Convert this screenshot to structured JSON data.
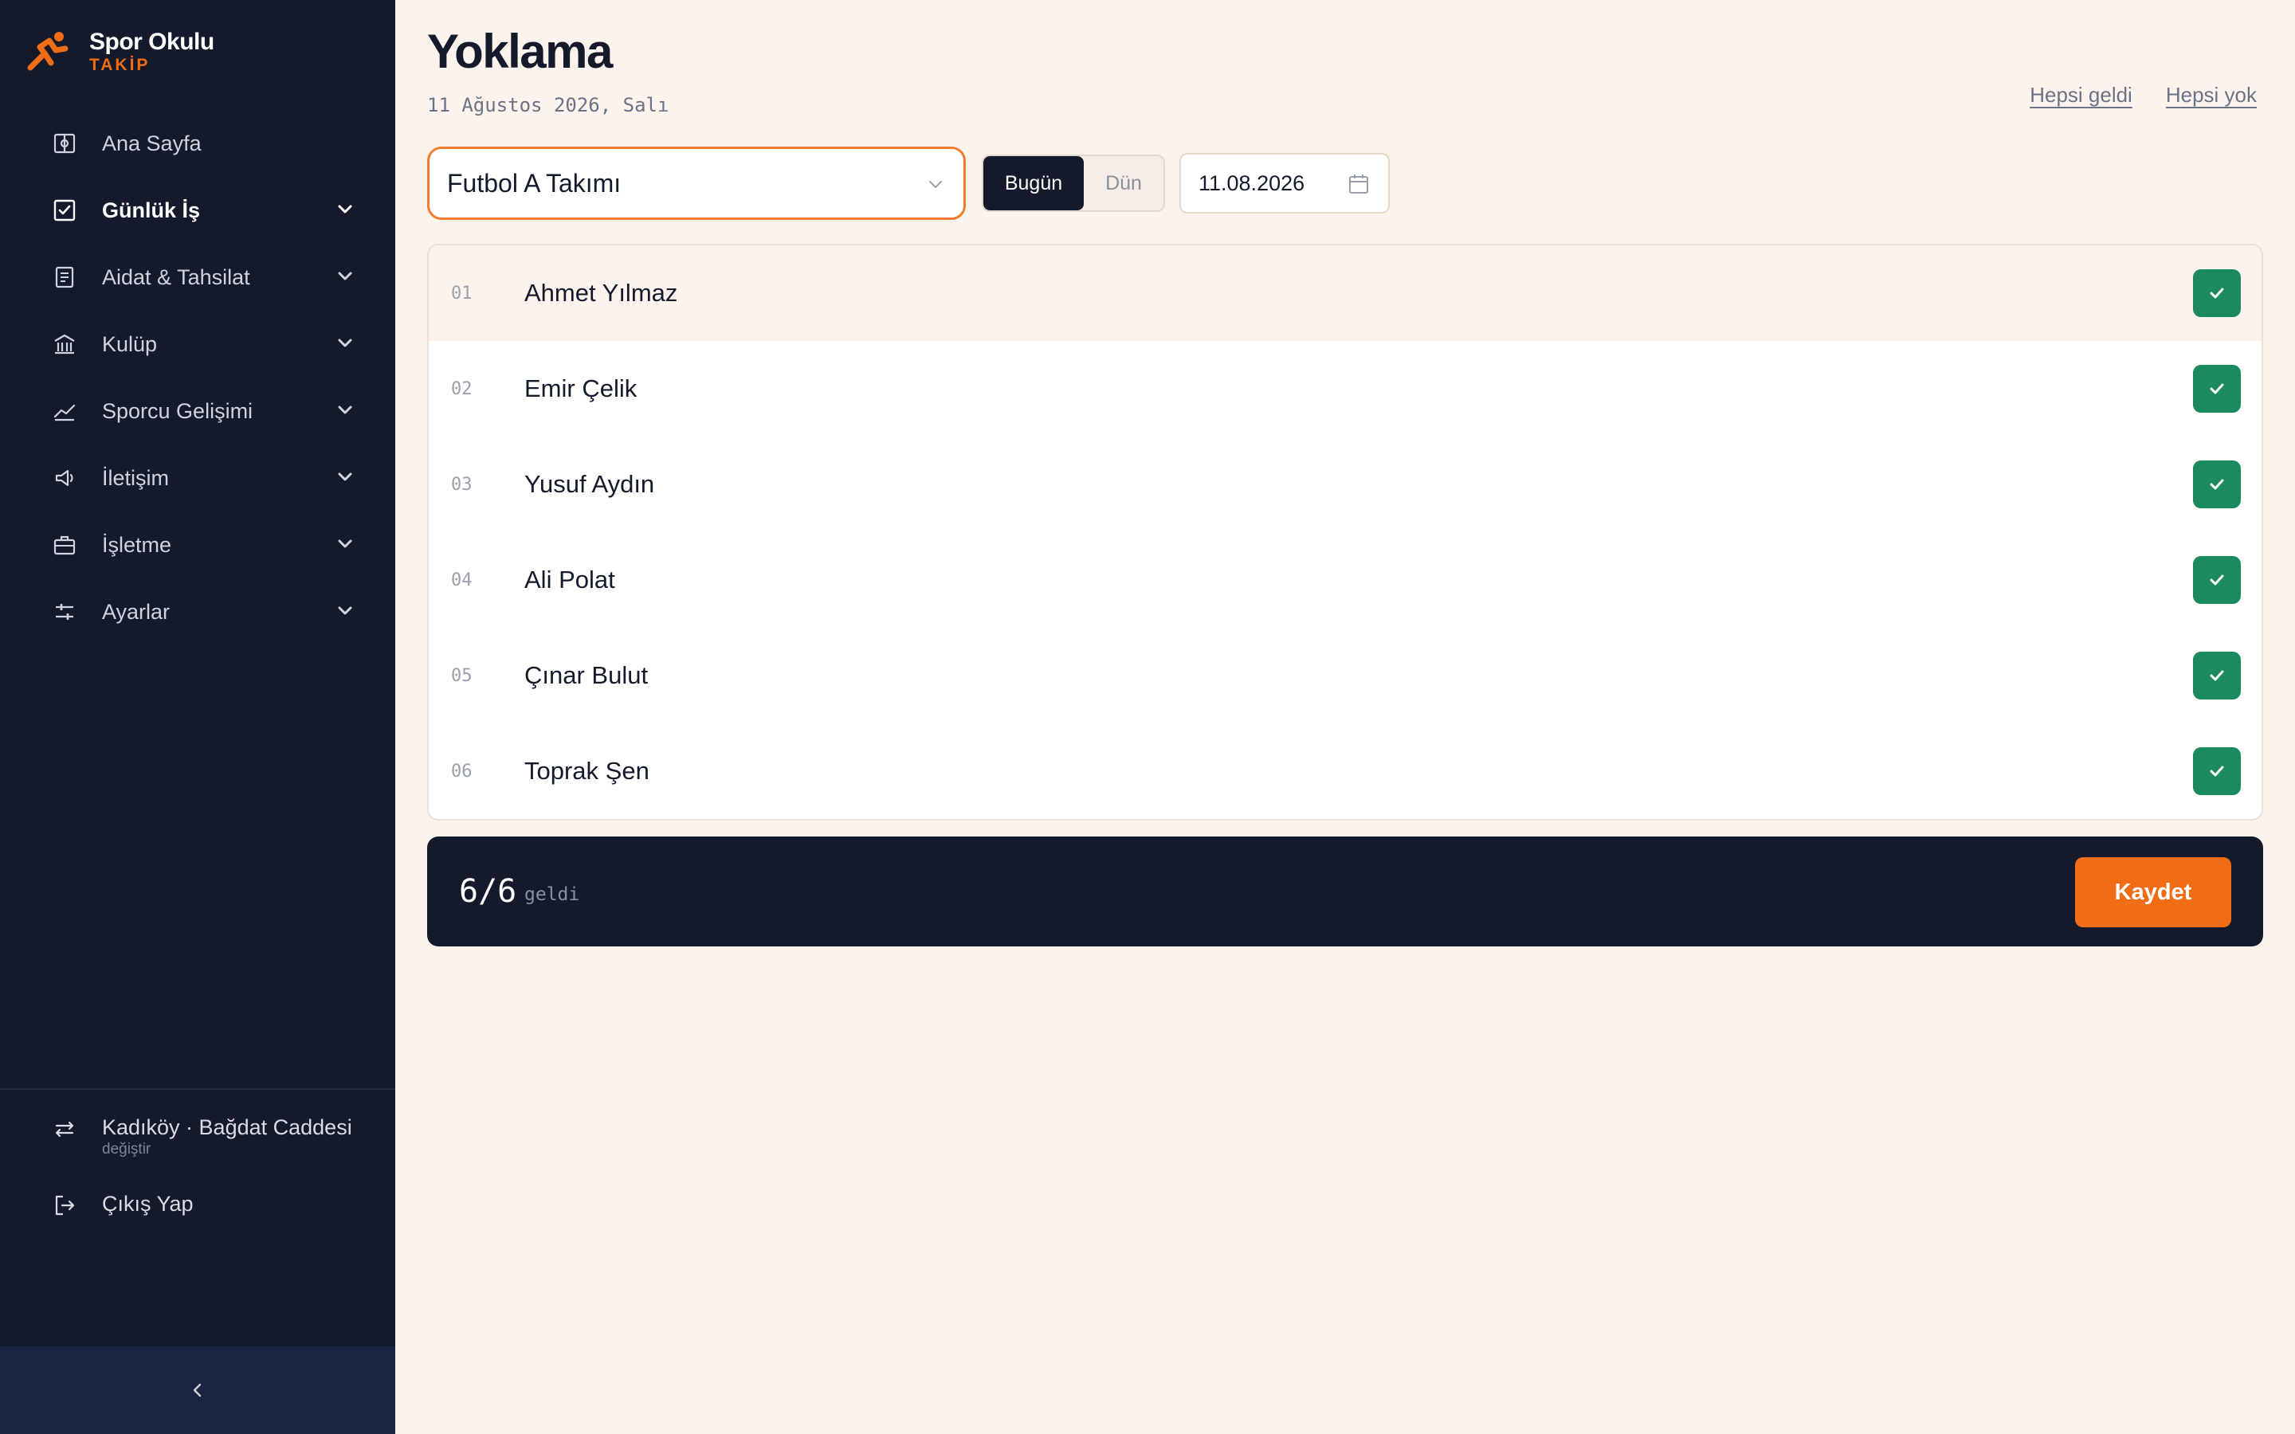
{
  "brand": {
    "name": "Spor Okulu",
    "sub": "TAKİP"
  },
  "sidebar": {
    "items": [
      {
        "label": "Ana Sayfa",
        "icon": "dashboard-icon"
      },
      {
        "label": "Günlük İş",
        "icon": "checkbox-icon",
        "active": true
      },
      {
        "label": "Aidat & Tahsilat",
        "icon": "document-icon"
      },
      {
        "label": "Kulüp",
        "icon": "building-icon"
      },
      {
        "label": "Sporcu Gelişimi",
        "icon": "chart-line-icon"
      },
      {
        "label": "İletişim",
        "icon": "megaphone-icon"
      },
      {
        "label": "İşletme",
        "icon": "briefcase-icon"
      },
      {
        "label": "Ayarlar",
        "icon": "sliders-icon"
      }
    ],
    "branch": {
      "label": "Kadıköy · Bağdat Caddesi",
      "sub": "değiştir"
    },
    "logout": "Çıkış Yap"
  },
  "page": {
    "title": "Yoklama",
    "date_text": "11 Ağustos 2026, Salı",
    "all_present": "Hepsi geldi",
    "all_absent": "Hepsi yok"
  },
  "filters": {
    "team": "Futbol A Takımı",
    "today": "Bugün",
    "yesterday": "Dün",
    "date": "11.08.2026"
  },
  "roster": [
    {
      "num": "01",
      "name": "Ahmet Yılmaz",
      "present": true
    },
    {
      "num": "02",
      "name": "Emir Çelik",
      "present": true
    },
    {
      "num": "03",
      "name": "Yusuf Aydın",
      "present": true
    },
    {
      "num": "04",
      "name": "Ali Polat",
      "present": true
    },
    {
      "num": "05",
      "name": "Çınar Bulut",
      "present": true
    },
    {
      "num": "06",
      "name": "Toprak Şen",
      "present": true
    }
  ],
  "summary": {
    "count": "6/6",
    "label": "geldi"
  },
  "save_label": "Kaydet",
  "colors": {
    "accent": "#f06c15",
    "sidebar": "#141a2c",
    "success": "#1b8a5f",
    "background": "#fcf3ed"
  }
}
